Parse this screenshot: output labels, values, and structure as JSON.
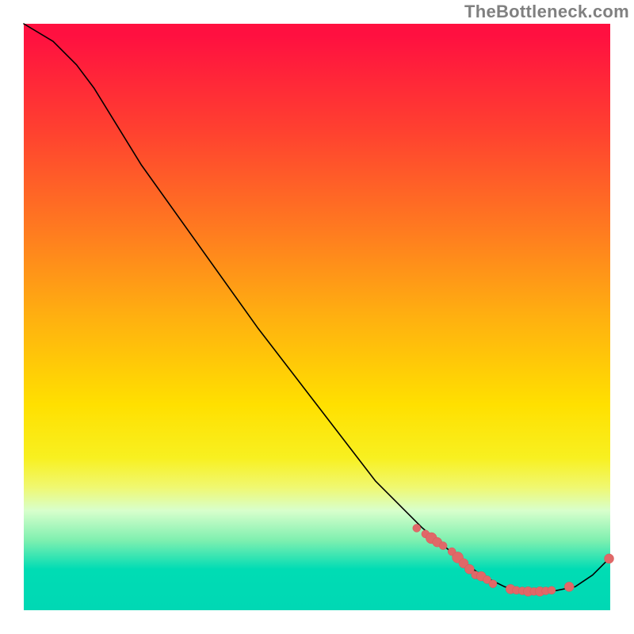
{
  "chart_data": {
    "type": "line",
    "title": "",
    "xlabel": "",
    "ylabel": "",
    "watermark": "TheBottleneck.com",
    "xlim": [
      0,
      100
    ],
    "ylim": [
      0,
      100
    ],
    "curve": [
      {
        "x": 0,
        "y": 100
      },
      {
        "x": 5,
        "y": 97
      },
      {
        "x": 9,
        "y": 93
      },
      {
        "x": 12,
        "y": 89
      },
      {
        "x": 20,
        "y": 76
      },
      {
        "x": 30,
        "y": 62
      },
      {
        "x": 40,
        "y": 48
      },
      {
        "x": 50,
        "y": 35
      },
      {
        "x": 60,
        "y": 22
      },
      {
        "x": 68,
        "y": 14
      },
      {
        "x": 74,
        "y": 9
      },
      {
        "x": 78,
        "y": 6
      },
      {
        "x": 82,
        "y": 4
      },
      {
        "x": 86,
        "y": 3.3
      },
      {
        "x": 90,
        "y": 3.2
      },
      {
        "x": 94,
        "y": 4
      },
      {
        "x": 97,
        "y": 6
      },
      {
        "x": 100,
        "y": 9
      }
    ],
    "data_points": [
      {
        "x": 67.0,
        "y": 14.0,
        "r": 5
      },
      {
        "x": 68.5,
        "y": 13.0,
        "r": 5
      },
      {
        "x": 69.5,
        "y": 12.3,
        "r": 7
      },
      {
        "x": 70.5,
        "y": 11.6,
        "r": 6
      },
      {
        "x": 71.5,
        "y": 11.0,
        "r": 5
      },
      {
        "x": 73.0,
        "y": 10.0,
        "r": 5
      },
      {
        "x": 74.0,
        "y": 9.0,
        "r": 7
      },
      {
        "x": 75.0,
        "y": 8.0,
        "r": 6
      },
      {
        "x": 76.0,
        "y": 7.0,
        "r": 6
      },
      {
        "x": 77.0,
        "y": 6.0,
        "r": 5
      },
      {
        "x": 78.0,
        "y": 5.8,
        "r": 6
      },
      {
        "x": 79.0,
        "y": 5.2,
        "r": 5
      },
      {
        "x": 80.0,
        "y": 4.5,
        "r": 5
      },
      {
        "x": 83.0,
        "y": 3.6,
        "r": 6
      },
      {
        "x": 84.0,
        "y": 3.4,
        "r": 5
      },
      {
        "x": 85.0,
        "y": 3.3,
        "r": 5
      },
      {
        "x": 86.0,
        "y": 3.2,
        "r": 6
      },
      {
        "x": 87.0,
        "y": 3.2,
        "r": 5
      },
      {
        "x": 88.0,
        "y": 3.2,
        "r": 6
      },
      {
        "x": 89.0,
        "y": 3.3,
        "r": 5
      },
      {
        "x": 90.0,
        "y": 3.4,
        "r": 5
      },
      {
        "x": 93.0,
        "y": 4.0,
        "r": 6
      },
      {
        "x": 99.8,
        "y": 8.8,
        "r": 6
      }
    ],
    "colors": {
      "curve": "#000000",
      "dot_fill": "#e06868",
      "gradient_top": "#ff1040",
      "gradient_bottom": "#00d8b4"
    }
  }
}
